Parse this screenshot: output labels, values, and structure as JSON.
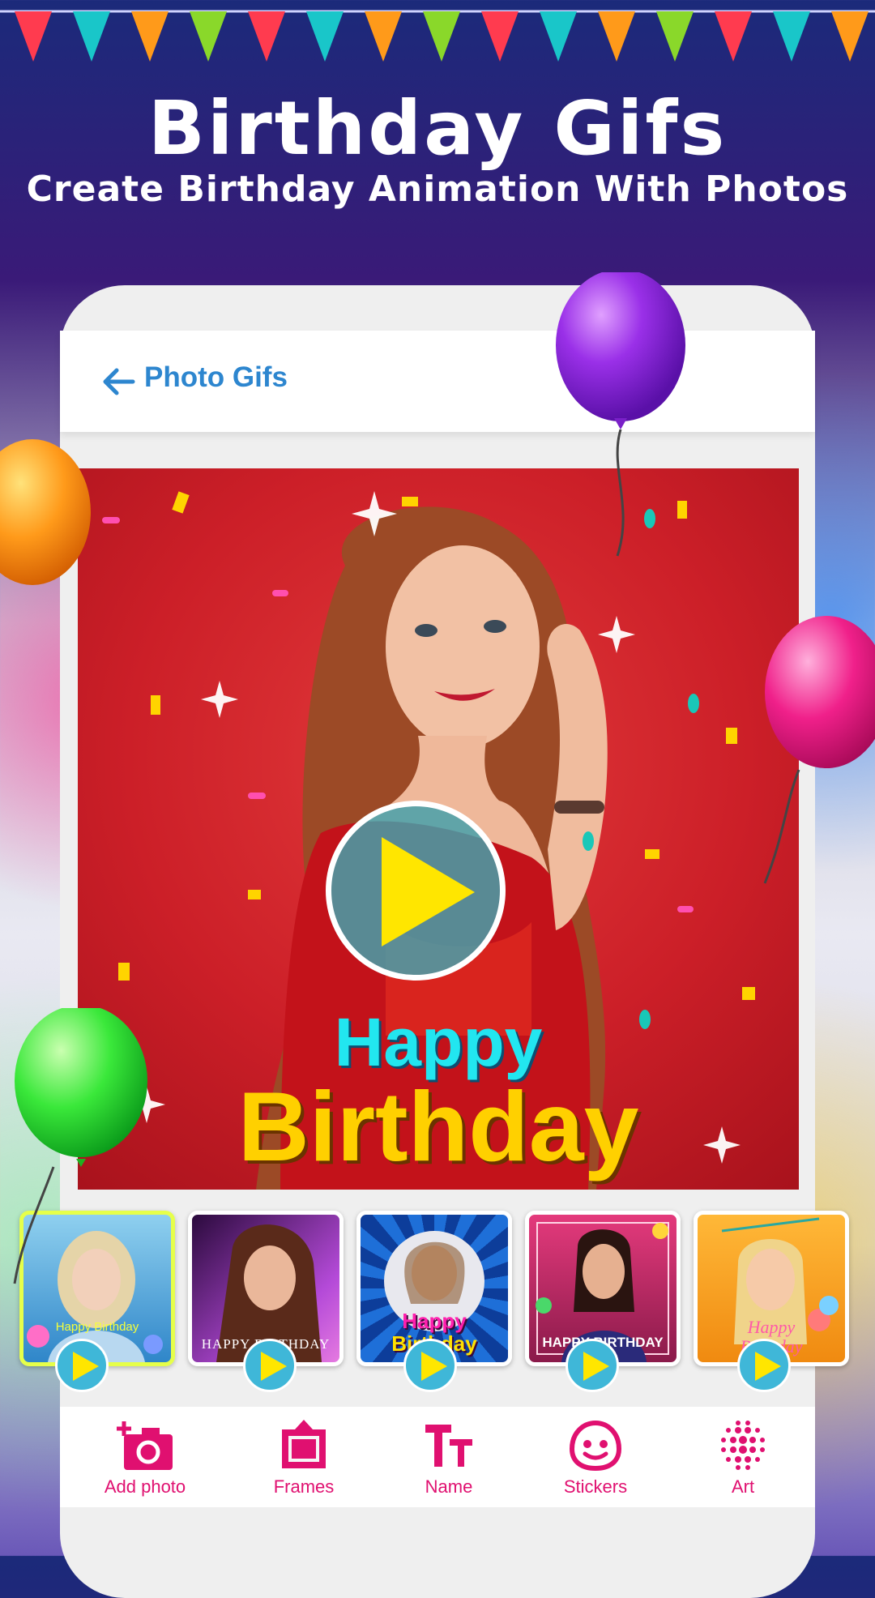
{
  "header": {
    "title": "Birthday Gifs",
    "subtitle": "Create Birthday Animation With Photos"
  },
  "app_bar": {
    "back_icon": "arrow-left-icon",
    "title": "Photo Gifs"
  },
  "preview": {
    "line1": "Happy",
    "line2": "Birthday",
    "play_icon": "play-icon"
  },
  "thumbnails": [
    {
      "caption": "Happy Birthday",
      "bg": "#4aa6d8"
    },
    {
      "caption": "HAPPY BIRTHDAY",
      "bg": "#8a3ab8"
    },
    {
      "caption_line1": "Happy",
      "caption_line2": "Birthday",
      "bg": "#1e6fd8"
    },
    {
      "caption": "HAPPY BIRTHDAY",
      "bg": "#c82060"
    },
    {
      "caption_line1": "Happy",
      "caption_line2": "Birthday",
      "bg": "#f5a020"
    }
  ],
  "toolbar": {
    "items": [
      {
        "label": "Add photo",
        "icon": "add-photo-icon"
      },
      {
        "label": "Frames",
        "icon": "frame-icon"
      },
      {
        "label": "Name",
        "icon": "text-icon"
      },
      {
        "label": "Stickers",
        "icon": "sticker-icon"
      },
      {
        "label": "Art",
        "icon": "art-icon"
      }
    ]
  },
  "colors": {
    "accent_pink": "#e01070",
    "title_blue": "#2d86cf",
    "play_yellow": "#ffe600"
  }
}
